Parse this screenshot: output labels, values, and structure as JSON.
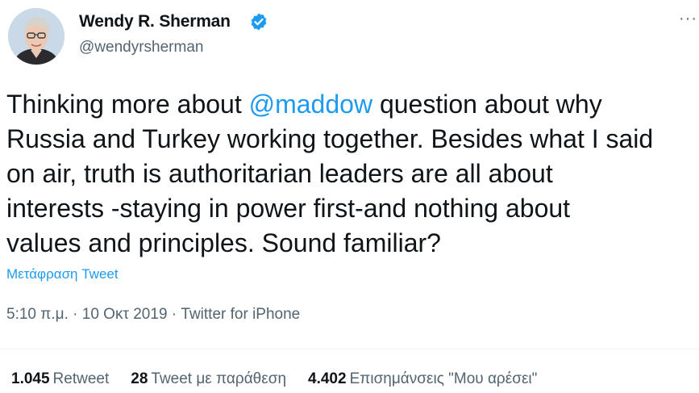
{
  "author": {
    "name": "Wendy R. Sherman",
    "handle": "@wendyrsherman",
    "verified": true
  },
  "tweet": {
    "line1_before": "Thinking more about ",
    "mention": "@maddow",
    "line1_after": " question about why",
    "line2": "Russia and Turkey working together. Besides what I said",
    "line3": "on air, truth is authoritarian leaders are all about",
    "line4": "interests -staying in power first-and nothing about",
    "line5": "values and principles. Sound familiar?"
  },
  "translate_label": "Μετάφραση Tweet",
  "meta": {
    "time": "5:10 π.μ.",
    "date": "10 Οκτ 2019",
    "source": "Twitter for iPhone",
    "separator": " · "
  },
  "stats": {
    "retweets_count": "1.045",
    "retweets_label": "Retweet",
    "quotes_count": "28",
    "quotes_label": "Tweet με παράθεση",
    "likes_count": "4.402",
    "likes_label": "Επισημάνσεις \"Μου αρέσει\""
  },
  "colors": {
    "accent": "#1d9bf0",
    "text": "#0f1419",
    "secondary": "#536471"
  },
  "icons": {
    "verified": "verified-badge-icon",
    "more": "more-horizontal-icon"
  }
}
